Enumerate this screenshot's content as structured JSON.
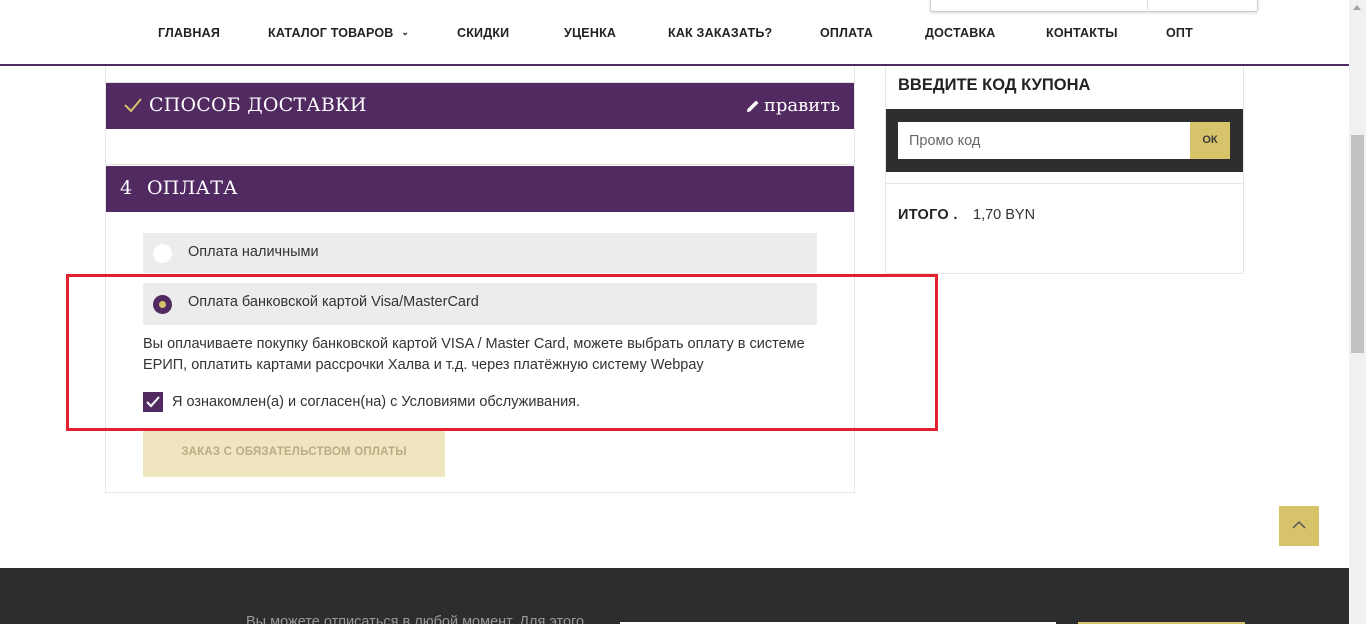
{
  "nav": {
    "items": [
      "ГЛАВНАЯ",
      "КАТАЛОГ ТОВАРОВ",
      "СКИДКИ",
      "УЦЕНКА",
      "КАК ЗАКАЗАТЬ?",
      "ОПЛАТА",
      "ДОСТАВКА",
      "КОНТАКТЫ",
      "ОПТ"
    ]
  },
  "checkout": {
    "delivery": {
      "title": "СПОСОБ ДОСТАВКИ",
      "edit_label": "править"
    },
    "payment": {
      "number": "4",
      "title": "ОПЛАТА",
      "options": [
        {
          "label": "Оплата наличными",
          "selected": false
        },
        {
          "label": "Оплата банковской картой Visa/MasterCard",
          "selected": true
        }
      ],
      "description": "Вы оплачиваете покупку банковской картой VISA / Master Card, можете выбрать оплату в системе ЕРИП, оплатить картами рассрочки Халва и т.д. через платёжную систему Webpay",
      "agree_label": "Я ознакомлен(а) и согласен(на) с Условиями обслуживания.",
      "submit_label": "ЗАКАЗ С ОБЯЗАТЕЛЬСТВОМ ОПЛАТЫ"
    }
  },
  "coupon": {
    "title": "ВВЕДИТЕ КОД КУПОНА",
    "placeholder": "Промо код",
    "value": "",
    "button_label": "ОК"
  },
  "total": {
    "label": "ИТОГО .",
    "value": "1,70 BYN"
  },
  "footer": {
    "text": "Вы можете отписаться в любой момент. Для этого"
  },
  "colors": {
    "brand_purple": "#522a62",
    "accent_gold": "#d7c36a",
    "highlight_red": "#e2202f"
  }
}
